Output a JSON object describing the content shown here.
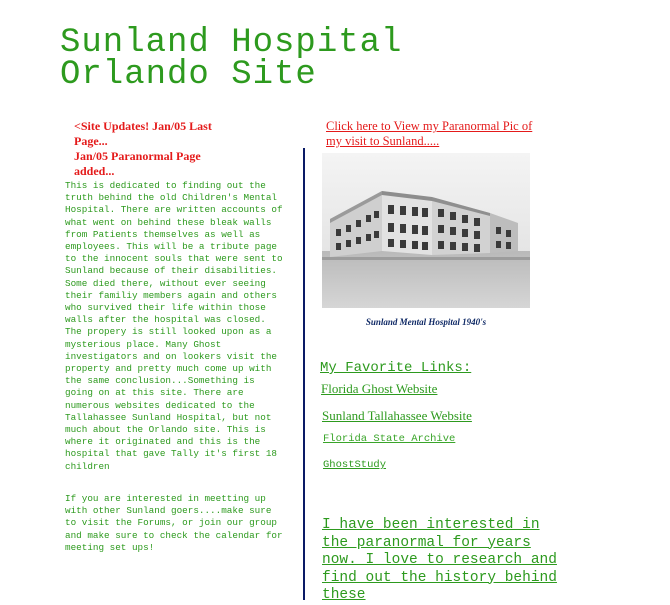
{
  "page": {
    "title_line1": "Sunland Hospital",
    "title_line2": "Orlando Site"
  },
  "updates": {
    "line1": "<Site Updates! Jan/05 Last",
    "line2": "Page...",
    "line3": "Jan/05 Paranormal Page",
    "line4": "added..."
  },
  "intro": {
    "text": "This is dedicated to finding out the truth behind the old Children's Mental Hospital. There are written accounts of what went on behind these bleak walls from Patients themselves as well as employees. This will be a tribute page to the innocent souls that were sent to Sunland because of their disabilities. Some died there, without ever seeing their familiy members again and others who survived their life within those walls after the hospital was closed. The propery is still looked upon as a mysterious place. Many Ghost investigators and on lookers visit the property and pretty much come up with the same conclusion...Something is going on at this site. There are numerous websites dedicated to the Tallahassee Sunland Hospital, but not much about the Orlando site. This is where it originated and this is the hospital that gave Tally it's first 18 children"
  },
  "forum": {
    "text": "If you are interested in meetting up with other Sunland goers....make sure to visit the Forums, or join our group and make sure to check the calendar for meeting set ups!"
  },
  "photo": {
    "link_text": "Click here to View my Paranormal Pic of my visit to Sunland.....",
    "caption": "Sunland Mental Hospital 1940's"
  },
  "favorites": {
    "heading": "My Favorite Links:",
    "links": [
      "Florida Ghost Website",
      "Sunland Tallahassee Website",
      "Florida State Archive",
      "GhostStudy"
    ]
  },
  "bio": {
    "text": "I have been interested in the paranormal for years now. I love to research and find out the history behind these"
  },
  "colors": {
    "green": "#2d9a1e",
    "red": "#e41a1a",
    "navy": "#0a1a66"
  }
}
